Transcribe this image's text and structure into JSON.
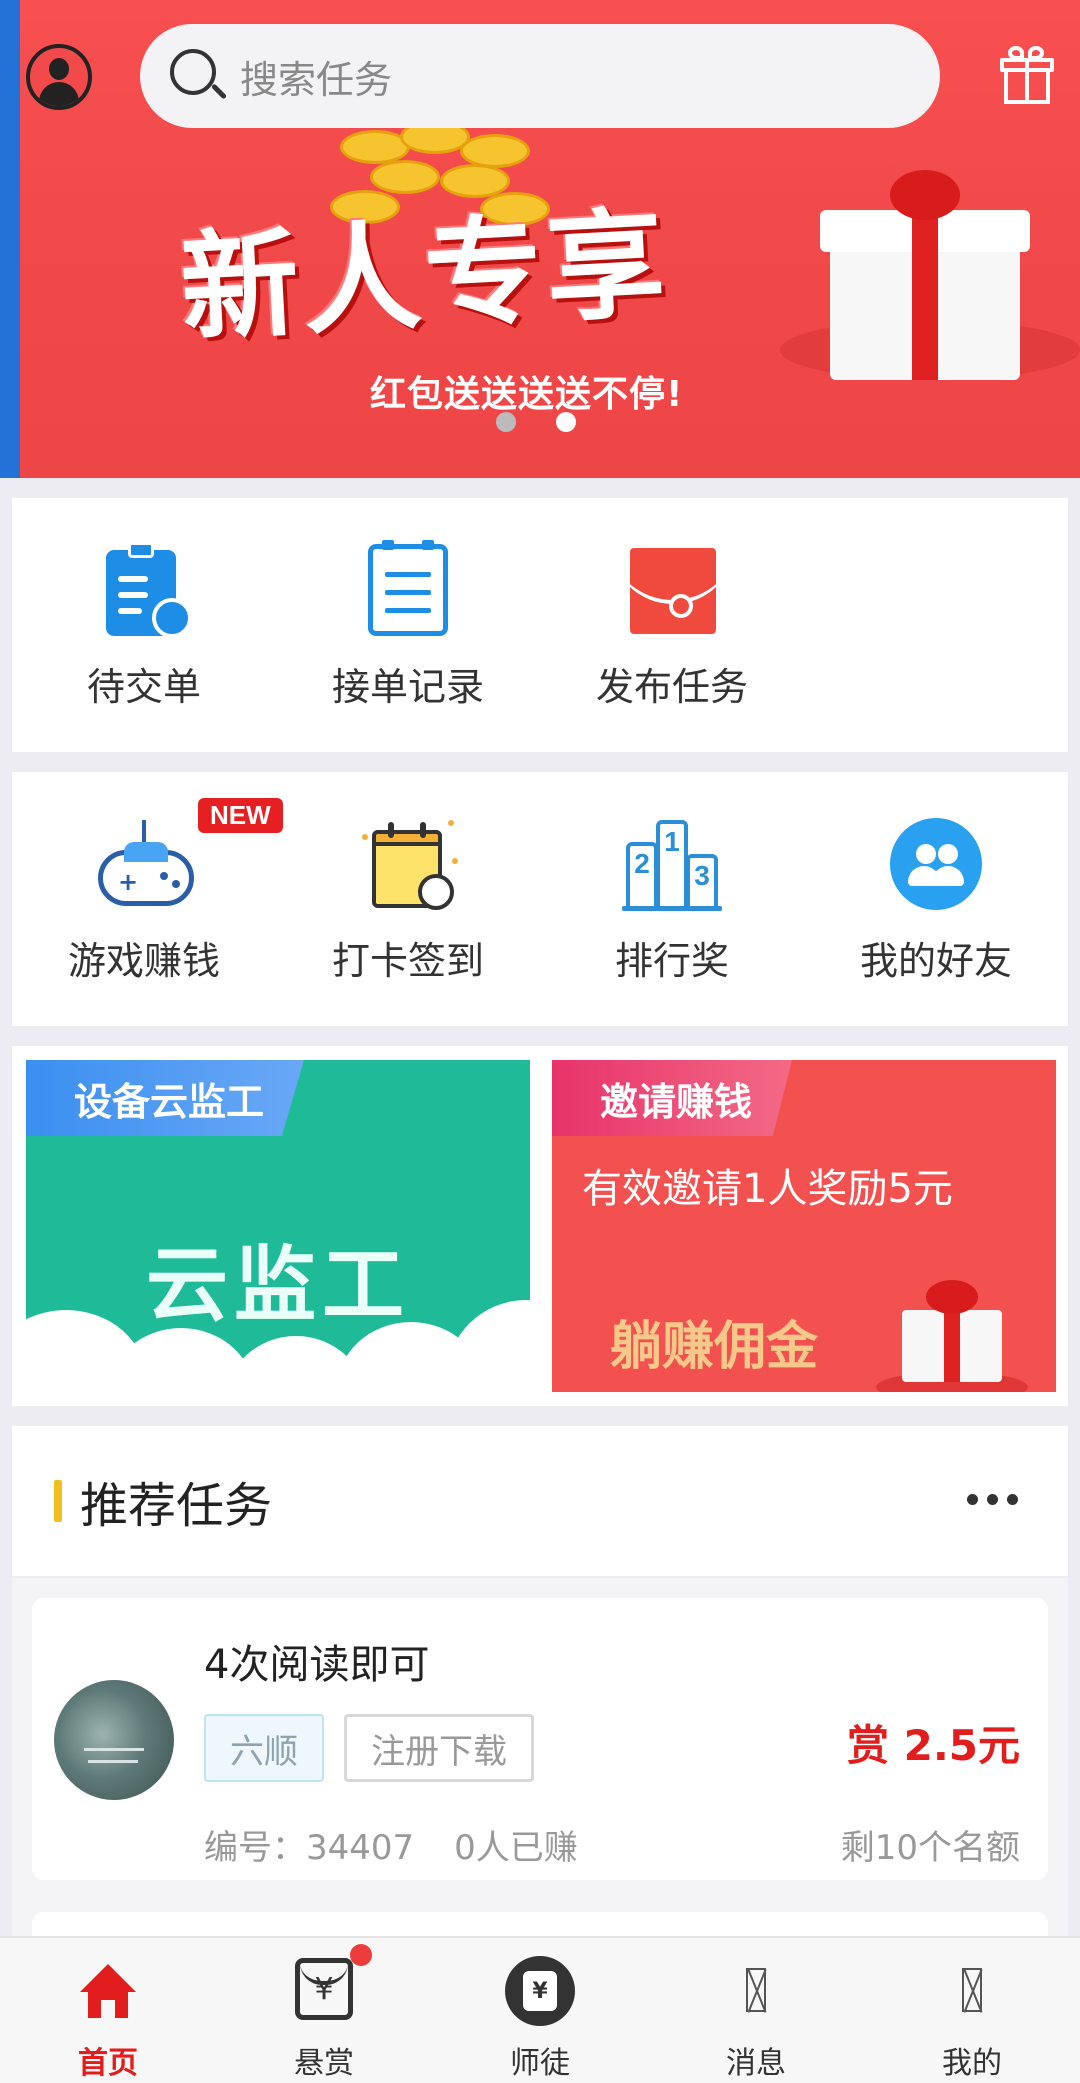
{
  "header": {
    "search_placeholder": "搜索任务"
  },
  "banner": {
    "headline": "新人专享",
    "subline": "红包送送送送不停!",
    "slide_count": 2,
    "active_slide": 2
  },
  "quick_actions": [
    {
      "label": "待交单",
      "icon": "clipboard-clock-icon"
    },
    {
      "label": "接单记录",
      "icon": "list-document-icon"
    },
    {
      "label": "发布任务",
      "icon": "red-envelope-icon"
    }
  ],
  "features": [
    {
      "label": "游戏赚钱",
      "icon": "gamepad-icon",
      "badge": "NEW"
    },
    {
      "label": "打卡签到",
      "icon": "calendar-check-icon"
    },
    {
      "label": "排行奖",
      "icon": "podium-icon"
    },
    {
      "label": "我的好友",
      "icon": "friends-icon"
    }
  ],
  "promos": {
    "cloud": {
      "tag": "设备云监工",
      "brand": "云监工"
    },
    "invite": {
      "tag": "邀请赚钱",
      "line1": "有效邀请1人奖励5元",
      "line2": "躺赚佣金"
    }
  },
  "recommended": {
    "title": "推荐任务",
    "tasks": [
      {
        "title": "4次阅读即可",
        "tags": [
          "六顺",
          "注册下载"
        ],
        "reward": "赏 2.5元",
        "id_text": "编号：34407",
        "earned_text": "0人已赚",
        "quota_text": "剩10个名额"
      }
    ]
  },
  "tabbar": {
    "items": [
      {
        "label": "首页",
        "icon": "home-icon",
        "active": true
      },
      {
        "label": "悬赏",
        "icon": "reward-envelope-icon",
        "dot": true
      },
      {
        "label": "师徒",
        "icon": "mentor-icon"
      },
      {
        "label": "消息",
        "icon": "message-icon"
      },
      {
        "label": "我的",
        "icon": "profile-icon"
      }
    ]
  },
  "colors": {
    "brand_red": "#e11d1d",
    "banner_red": "#f04848",
    "accent_blue": "#1e8de6",
    "accent_yellow": "#f2c01c"
  }
}
